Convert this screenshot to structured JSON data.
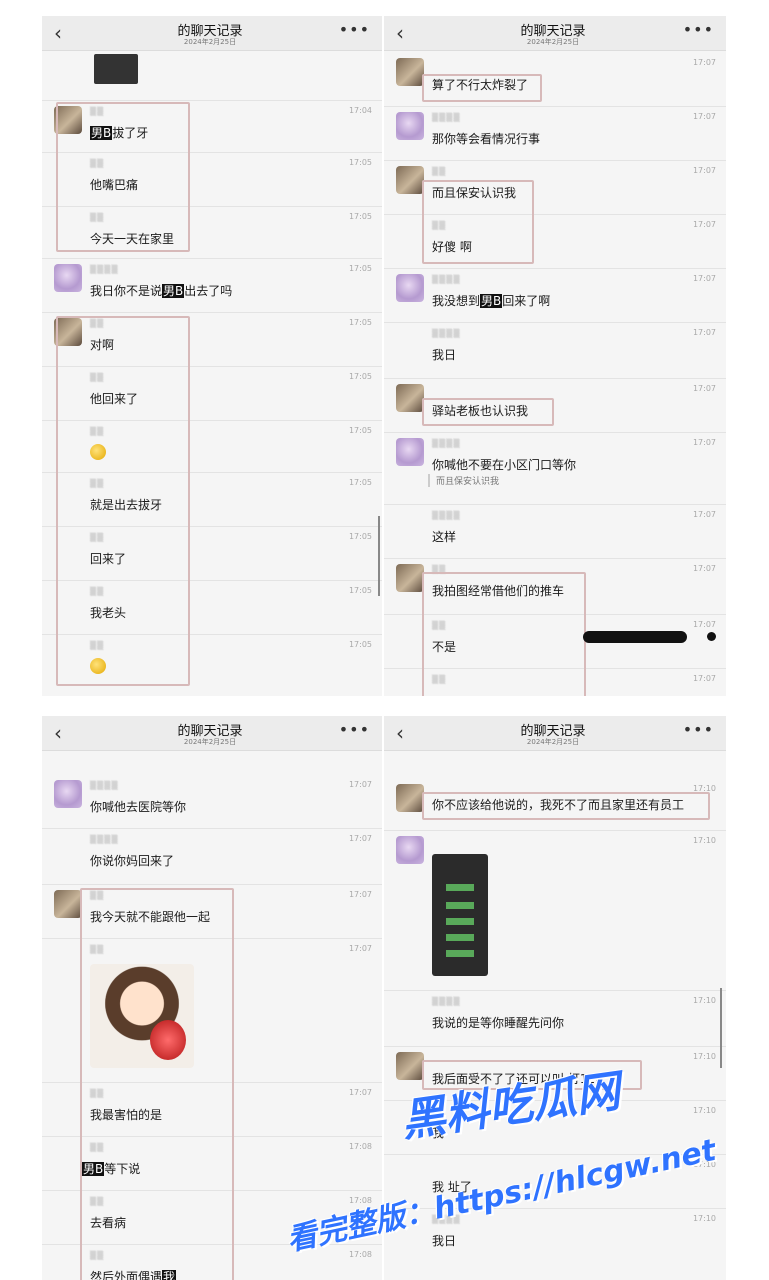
{
  "panels": [
    {
      "title": "的聊天记录",
      "date": "2024年2月25日",
      "back_icon": "‹",
      "more_icon": "•••",
      "messages": [
        {
          "avatar": "girl",
          "name": "",
          "time": "17:04",
          "pre": "男B",
          "text": "拔了牙",
          "post": ""
        },
        {
          "avatar": "girl",
          "name": "",
          "time": "17:05",
          "pre": "",
          "text": "他嘴巴痛",
          "post": ""
        },
        {
          "avatar": "girl",
          "name": "",
          "time": "17:05",
          "pre": "",
          "text": "今天一天在家里",
          "post": ""
        },
        {
          "avatar": "purple",
          "name": "",
          "time": "17:05",
          "pre": "我日你不是说",
          "tag": "男B",
          "text": "出去了吗",
          "post": ""
        },
        {
          "avatar": "girl",
          "name": "",
          "time": "17:05",
          "pre": "",
          "text": "对啊",
          "post": ""
        },
        {
          "avatar": "girl",
          "name": "",
          "time": "17:05",
          "pre": "",
          "text": "他回来了",
          "post": ""
        },
        {
          "avatar": "girl",
          "name": "",
          "time": "17:05",
          "pre": "",
          "text": "",
          "sticker": "emoji-sticker",
          "post": ""
        },
        {
          "avatar": "girl",
          "name": "",
          "time": "17:05",
          "pre": "",
          "text": "就是出去拔牙",
          "post": ""
        },
        {
          "avatar": "girl",
          "name": "",
          "time": "17:05",
          "pre": "",
          "text": "回来了",
          "post": ""
        },
        {
          "avatar": "girl",
          "name": "",
          "time": "17:05",
          "pre": "",
          "text": "我老头",
          "post": ""
        },
        {
          "avatar": "girl",
          "name": "",
          "time": "17:05",
          "pre": "",
          "text": "",
          "sticker": "emoji-sticker",
          "post": ""
        }
      ]
    },
    {
      "title": "的聊天记录",
      "date": "2024年2月25日",
      "back_icon": "‹",
      "more_icon": "•••",
      "messages": [
        {
          "avatar": "girl",
          "time": "17:07",
          "text": "算了不行太炸裂了"
        },
        {
          "avatar": "purple",
          "time": "17:07",
          "text": "那你等会看情况行事"
        },
        {
          "avatar": "girl",
          "time": "17:07",
          "text": "而且保安认识我"
        },
        {
          "avatar": "girl",
          "time": "17:07",
          "text": "好傻 啊"
        },
        {
          "avatar": "purple",
          "time": "17:07",
          "pre": "我没想到",
          "tag": "男B",
          "text": "回来了啊"
        },
        {
          "avatar": "purple",
          "time": "17:07",
          "text": "我日"
        },
        {
          "avatar": "girl",
          "time": "17:07",
          "text": "驿站老板也认识我"
        },
        {
          "avatar": "purple",
          "time": "17:07",
          "text": "你喊他不要在小区门口等你",
          "quote": "而且保安认识我"
        },
        {
          "avatar": "purple",
          "time": "17:07",
          "text": "这样"
        },
        {
          "avatar": "girl",
          "time": "17:07",
          "text": "我拍图经常借他们的推车"
        },
        {
          "avatar": "girl",
          "time": "17:07",
          "text": "不是"
        },
        {
          "avatar": "girl",
          "time": "17:07",
          "text": ""
        }
      ]
    },
    {
      "title": "的聊天记录",
      "date": "2024年2月25日",
      "back_icon": "‹",
      "more_icon": "•••",
      "messages": [
        {
          "avatar": "purple",
          "time": "17:07",
          "text": "你喊他去医院等你"
        },
        {
          "avatar": "purple",
          "time": "17:07",
          "text": "你说你妈回来了"
        },
        {
          "avatar": "girl",
          "time": "17:07",
          "text": "我今天就不能跟他一起"
        },
        {
          "avatar": "girl",
          "time": "17:07",
          "text": "",
          "image": "kid-sticker"
        },
        {
          "avatar": "girl",
          "time": "17:07",
          "text": "我最害怕的是"
        },
        {
          "avatar": "girl",
          "time": "17:08",
          "pre": "",
          "tag": "男B",
          "text": "等下说"
        },
        {
          "avatar": "girl",
          "time": "17:08",
          "text": "去看病"
        },
        {
          "avatar": "girl",
          "time": "17:08",
          "text": "然后外面偶遇",
          "tag2": "我"
        }
      ]
    },
    {
      "title": "的聊天记录",
      "date": "2024年2月25日",
      "back_icon": "‹",
      "more_icon": "•••",
      "messages": [
        {
          "avatar": "girl",
          "time": "17:10",
          "text": "你不应该给他说的，我死不了而且家里还有员工"
        },
        {
          "avatar": "purple",
          "time": "17:10",
          "text": "",
          "image": "chat-screenshot"
        },
        {
          "avatar": "purple",
          "time": "17:10",
          "text": "我说的是等你睡醒先问你"
        },
        {
          "avatar": "girl",
          "time": "17:10",
          "text": "我后面受不了了还可以叫 打120"
        },
        {
          "avatar": "purple",
          "time": "17:10",
          "text": "我"
        },
        {
          "avatar": "purple",
          "time": "17:10",
          "text": "我 址了"
        },
        {
          "avatar": "purple",
          "time": "17:10",
          "text": "我日"
        }
      ]
    }
  ],
  "watermark": {
    "line1": "黑料吃瓜网",
    "line2": "看完整版：https://hlcgw.net"
  },
  "colors": {
    "highlight_box": "#d7b9b9",
    "watermark": "#2f73ff",
    "timestamp": "#a9a9a9"
  }
}
